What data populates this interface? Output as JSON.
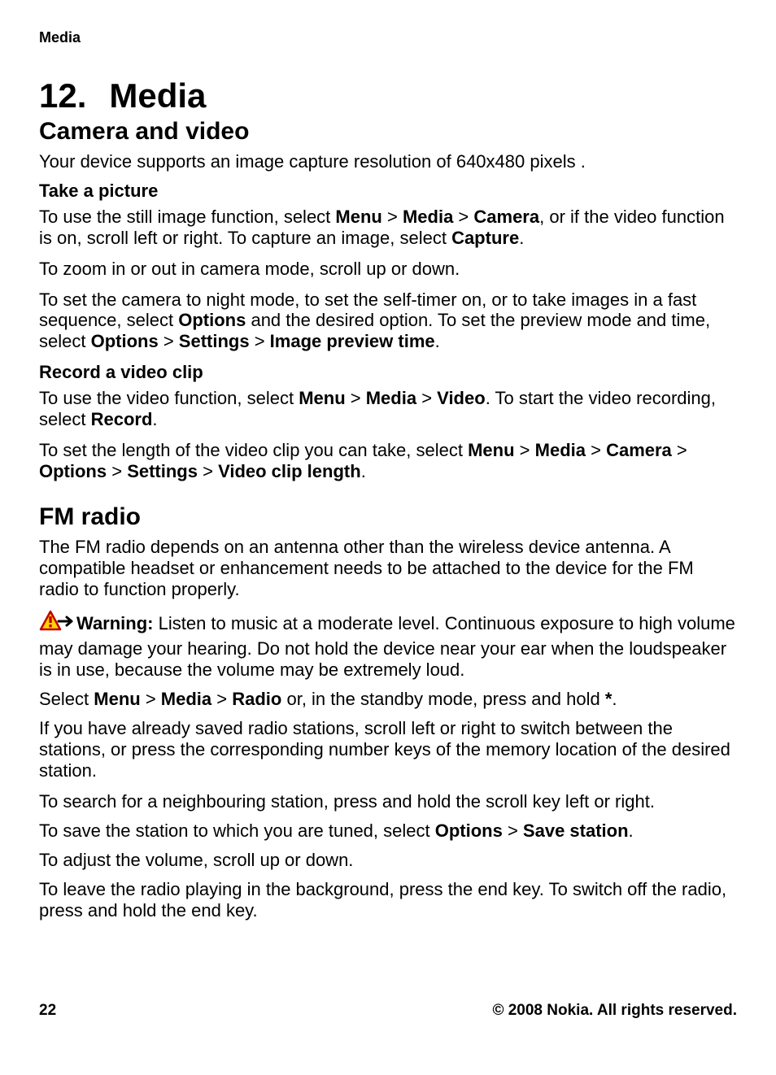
{
  "running_head": "Media",
  "chapter": {
    "num": "12.",
    "title": "Media"
  },
  "s1": {
    "title": "Camera and video",
    "intro": "Your device supports an image capture resolution of 640x480 pixels .",
    "sub1": {
      "title": "Take a picture",
      "p1a": "To use the still image function, select ",
      "p1b": "Menu",
      "p1c": "Media",
      "p1d": "Camera",
      "p1e": ", or if the video function is on, scroll left or right. To capture an image, select ",
      "p1f": "Capture",
      "p1g": ".",
      "p2": "To zoom in or out in camera mode, scroll up or down.",
      "p3a": "To set the camera to night mode, to set the self-timer on, or to take images in a fast sequence, select ",
      "p3b": "Options",
      "p3c": " and the desired option. To set the preview mode and time, select ",
      "p3d": "Options",
      "p3e": "Settings",
      "p3f": "Image preview time",
      "p3g": "."
    },
    "sub2": {
      "title": "Record a video clip",
      "p1a": "To use the video function, select ",
      "p1b": "Menu",
      "p1c": "Media",
      "p1d": "Video",
      "p1e": ". To start the video recording, select ",
      "p1f": "Record",
      "p1g": ".",
      "p2a": "To set the length of the video clip you can take, select ",
      "p2b": "Menu",
      "p2c": "Media",
      "p2d": "Camera",
      "p2e": "Options",
      "p2f": "Settings",
      "p2g": "Video clip length",
      "p2h": "."
    }
  },
  "s2": {
    "title": "FM radio",
    "p1": "The FM radio depends on an antenna other than the wireless device antenna. A compatible headset or enhancement needs to be attached to the device for the FM radio to function properly.",
    "warn_label": "Warning:",
    "warn_body": " Listen to music at a moderate level. Continuous exposure to high volume may damage your hearing. Do not hold the device near your ear when the loudspeaker is in use, because the volume may be extremely loud.",
    "p3a": "Select ",
    "p3b": "Menu",
    "p3c": "Media",
    "p3d": "Radio",
    "p3e": " or, in the standby mode, press and hold ",
    "p3f": "*",
    "p3g": ".",
    "p4": "If you have already saved radio stations, scroll left or right to switch between the stations, or press the corresponding number keys of the memory location of the desired station.",
    "p5": "To search for a neighbouring station, press and hold the scroll key left or right.",
    "p6a": "To save the station to which you are tuned, select ",
    "p6b": "Options",
    "p6c": "Save station",
    "p6d": ".",
    "p7": "To adjust the volume, scroll up or down.",
    "p8": "To leave the radio playing in the background, press the end key. To switch off the radio, press and hold the end key."
  },
  "gt": " > ",
  "footer": {
    "page": "22",
    "copyright": "© 2008 Nokia. All rights reserved."
  }
}
